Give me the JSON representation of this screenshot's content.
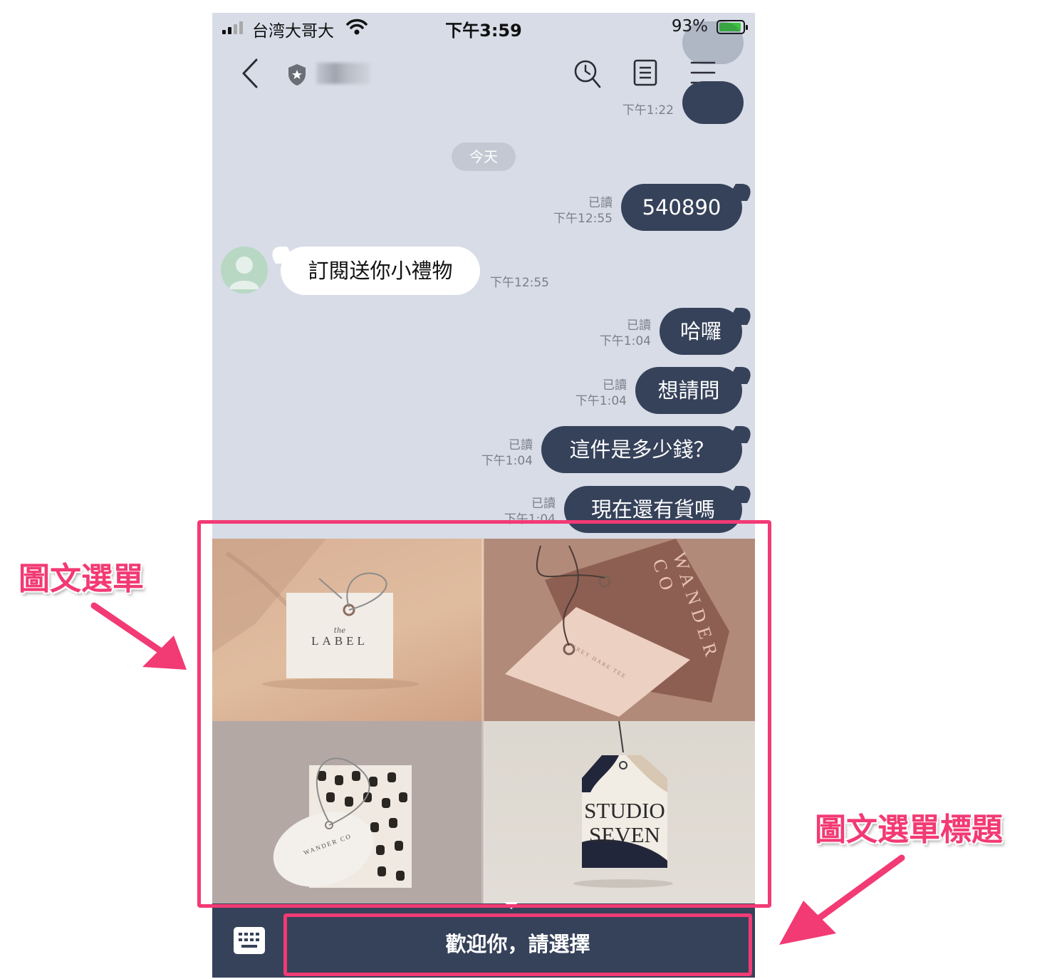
{
  "status_bar": {
    "carrier": "台湾大哥大",
    "time": "下午3:59",
    "battery": "93%",
    "battery_level": 0.93
  },
  "header": {
    "icons": [
      "back-icon",
      "shield-icon",
      "search-history-icon",
      "notes-icon",
      "menu-icon"
    ]
  },
  "chat": {
    "top_time": "下午1:22",
    "date_label": "今天",
    "messages": [
      {
        "dir": "out",
        "text": "540890",
        "read": "已讀",
        "time": "下午12:55"
      },
      {
        "dir": "in",
        "text": "訂閱送你小禮物",
        "time": "下午12:55"
      },
      {
        "dir": "out",
        "text": "哈囉",
        "read": "已讀",
        "time": "下午1:04"
      },
      {
        "dir": "out",
        "text": "想請問",
        "read": "已讀",
        "time": "下午1:04"
      },
      {
        "dir": "out",
        "text": "這件是多少錢？",
        "read": "已讀",
        "time": "下午1:04"
      },
      {
        "dir": "out",
        "text": "現在還有貨嗎",
        "read": "已讀",
        "time": "下午1:04"
      }
    ]
  },
  "rich_menu": {
    "tiles": [
      {
        "line1": "the",
        "line2": "LABEL"
      },
      {
        "side_text": "WANDER CO",
        "tag_text": "GREY HARE TEE"
      },
      {
        "tag_text": "WANDER CO"
      },
      {
        "line1": "STUDIO",
        "line2": "SEVEN"
      }
    ],
    "title": "歡迎你，請選擇"
  },
  "annotations": {
    "rich_menu_label": "圖文選單",
    "rich_menu_title_label": "圖文選單標題"
  },
  "colors": {
    "chat_bg": "#d7dce7",
    "bubble_out": "#36425a",
    "highlight": "#f23a74"
  }
}
